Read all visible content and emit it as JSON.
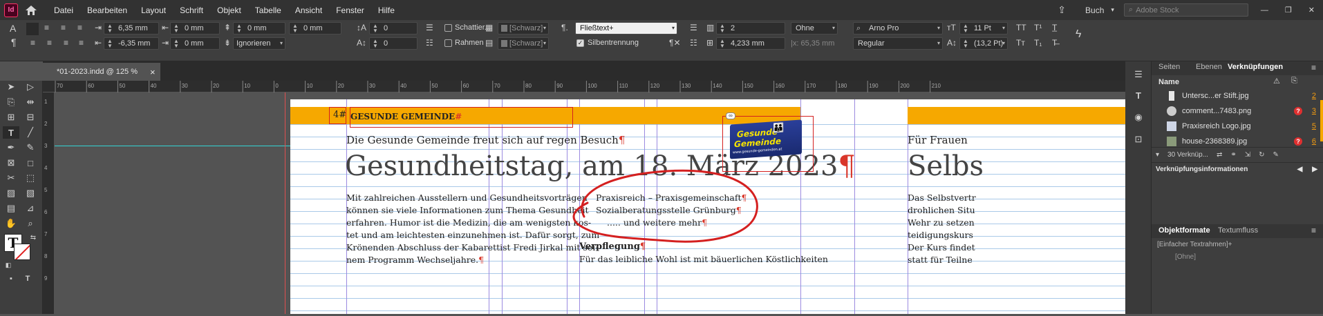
{
  "menubar": {
    "app_icon": "Id",
    "items": [
      "Datei",
      "Bearbeiten",
      "Layout",
      "Schrift",
      "Objekt",
      "Tabelle",
      "Ansicht",
      "Fenster",
      "Hilfe"
    ],
    "workspace": "Buch",
    "search_placeholder": "Adobe Stock"
  },
  "control": {
    "indent_left": "6,35 mm",
    "indent_right_neg": "-6,35 mm",
    "zero1": "0 mm",
    "zero2": "0 mm",
    "zero3": "0 mm",
    "zero4": "0 mm",
    "zero5": "0 mm",
    "spacing_a": "0",
    "spacing_b": "0",
    "ignore": "Ignorieren",
    "shading_label": "Schattier...",
    "frame_label": "Rahmen",
    "swatch1": "[Schwarz]",
    "swatch2": "[Schwarz]",
    "para_style": "Fließtext+",
    "hyphenation_label": "Silbentrennung",
    "columns": "2",
    "gutter": "4,233 mm",
    "col_width": "65,35 mm",
    "ohne": "Ohne",
    "font_family": "Arno Pro",
    "font_style": "Regular",
    "font_size": "11 Pt",
    "leading": "(13,2 Pt)"
  },
  "document_tab": {
    "title": "*01-2023.indd @ 125 %",
    "close": "×"
  },
  "ruler_marks": [
    "70",
    "60",
    "50",
    "40",
    "30",
    "20",
    "10",
    "0",
    "10",
    "20",
    "30",
    "40",
    "50",
    "60",
    "70",
    "80",
    "90",
    "100",
    "110",
    "120",
    "130",
    "140",
    "150",
    "160",
    "170",
    "180",
    "190",
    "200",
    "210"
  ],
  "page": {
    "page_number": "4#",
    "banner_title": "GESUNDE GEMEINDE",
    "banner_hash": "#",
    "subhead": "Die Gesunde Gemeinde freut sich auf regen Besuch",
    "headline": "Gesundheitstag, am 18. März 2023",
    "body_lines": [
      "Mit zahlreichen Ausstellern und Gesundheitsvorträgen",
      "können sie viele Informationen zum Thema Gesundheit",
      "erfahren. Humor ist die Medizin, die am wenigsten kos-",
      "tet und am leichtesten einzunehmen ist. Dafür sorgt, zum",
      "Krönenden Abschluss der Kabarettist Fredi Jirkal mit sei-",
      "nem Programm Wechseljahre."
    ],
    "list_lines": [
      "Praxisreich – Praxisgemeinschaft",
      "Sozialberatungsstelle Grünburg",
      "..... und weitere mehr"
    ],
    "verpflegung": "Verpflegung",
    "verpflegung_text": "Für das leibliche Wohl ist mit bäuerlichen Köstlichkeiten",
    "logo_text_1": "Gesunde",
    "logo_text_2": "Gemeinde",
    "logo_url": "www.gesunde-gemeinden.at",
    "right_subhead": "Für Frauen",
    "right_headline": "Selbs",
    "right_body": [
      "Das Selbstvertr",
      "drohlichen Situ",
      "Wehr zu setzen",
      "teidigungskurs",
      "Der Kurs findet",
      "statt für Teilne"
    ]
  },
  "panel": {
    "tabs": [
      "Seiten",
      "Ebenen",
      "Verknüpfungen"
    ],
    "col_name": "Name",
    "links": [
      {
        "name": "Untersc...er Stift.jpg",
        "page": "2",
        "warn": false
      },
      {
        "name": "comment...7483.png",
        "page": "3",
        "warn": true
      },
      {
        "name": "Praxisreich Logo.jpg",
        "page": "5",
        "warn": false
      },
      {
        "name": "house-2368389.jpg",
        "page": "6",
        "warn": true
      }
    ],
    "link_count": "30 Verknüp...",
    "info_label": "Verknüpfungsinformationen",
    "bottom_tabs": [
      "Objektformate",
      "Textumfluss"
    ],
    "object_style": "[Einfacher Textrahmen]+",
    "object_style_2": "[Ohne]"
  },
  "colors": {
    "banner": "#f6a800",
    "pilcrow": "#d9362a",
    "annotation": "#d42020",
    "link_warn": "#e03030"
  }
}
